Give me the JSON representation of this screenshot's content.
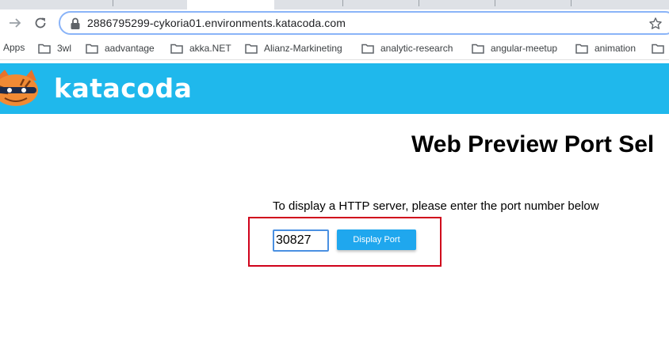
{
  "browser": {
    "url": "2886795299-cykoria01.environments.katacoda.com",
    "bookmarks": {
      "apps_label": "Apps",
      "items": [
        {
          "label": "3wl"
        },
        {
          "label": "aadvantage"
        },
        {
          "label": "akka.NET"
        },
        {
          "label": "Alianz-Markineting"
        },
        {
          "label": "analytic-research"
        },
        {
          "label": "angular-meetup"
        },
        {
          "label": "animation"
        }
      ]
    }
  },
  "header": {
    "logo_text": "katacoda",
    "brand_color": "#1fb8ec"
  },
  "main": {
    "title": "Web Preview Port Sel",
    "instruction": "To display a HTTP server, please enter the port number below",
    "port_value": "30827",
    "display_button_label": "Display Port",
    "highlight_color": "#d0021b",
    "button_color": "#1fa7ee"
  }
}
